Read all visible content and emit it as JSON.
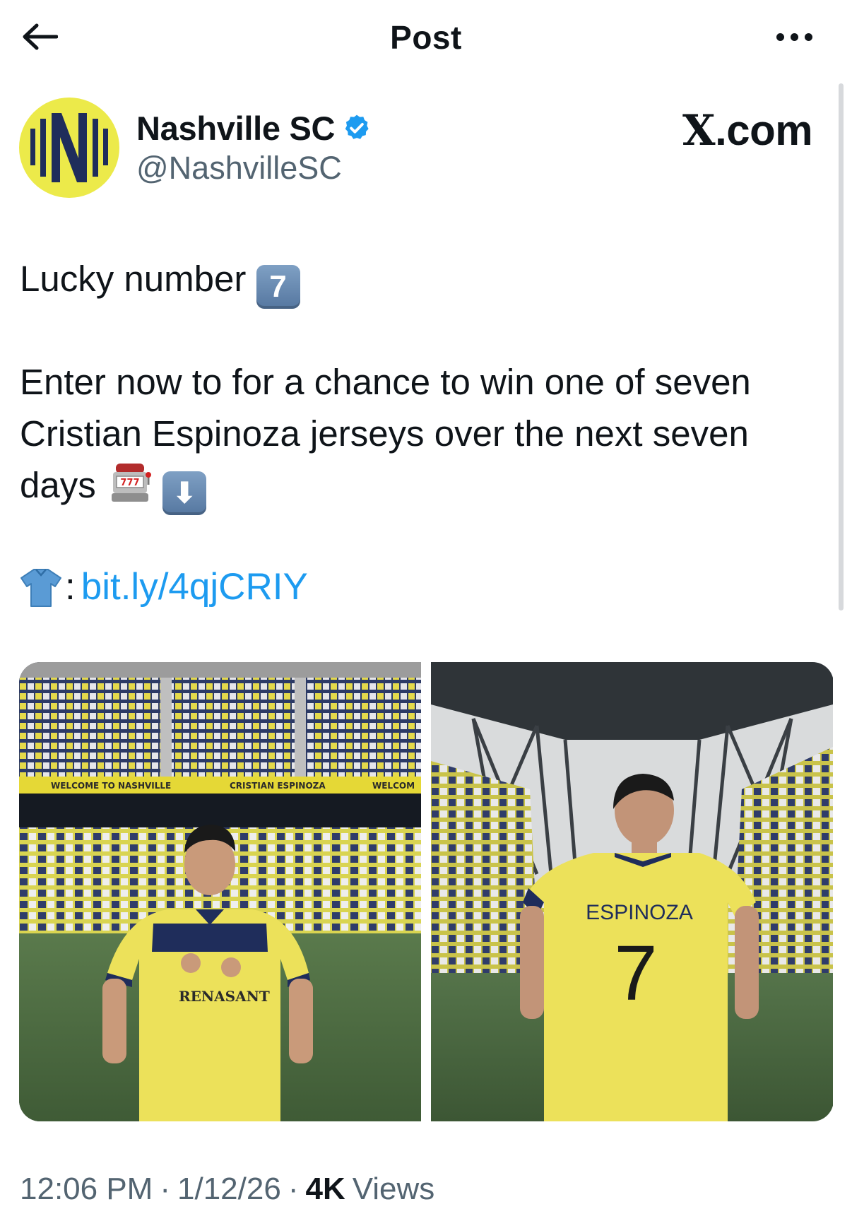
{
  "header": {
    "title": "Post"
  },
  "author": {
    "display_name": "Nashville SC",
    "handle": "@NashvilleSC",
    "verified": true,
    "verified_color": "#1d9bf0",
    "avatar_bg": "#ecea4a",
    "avatar_fg": "#1f2d5b"
  },
  "source": {
    "label": "X",
    "suffix": ".com"
  },
  "post": {
    "line1": "Lucky number",
    "line1_emoji": "7",
    "paragraph2": "Enter now to for a chance to win one of seven Cristian Espinoza jerseys over the next seven days",
    "emoji_slot_machine": "slot-machine",
    "emoji_down_arrow": "⬇",
    "link_prefix": ":",
    "link_text": "bit.ly/4qjCRIY"
  },
  "media": {
    "banner_left": "WELCOME TO NASHVILLE",
    "banner_mid": "CRISTIAN ESPINOZA",
    "banner_right": "WELCOM",
    "sponsor": "RENASANT",
    "jersey_name": "ESPINOZA",
    "jersey_number": "7",
    "colors": {
      "jersey_yellow": "#ece15a",
      "navy": "#1f2d5b",
      "grass": "#4f6d43"
    }
  },
  "meta": {
    "time": "12:06 PM",
    "sep1": "·",
    "date": "1/12/26",
    "sep2": "·",
    "views_count": "4K",
    "views_label": "Views"
  }
}
